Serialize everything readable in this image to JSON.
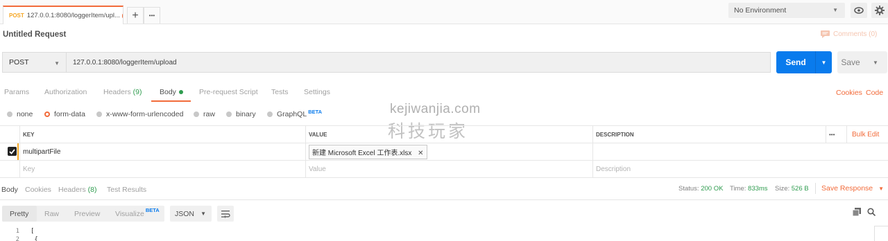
{
  "tab": {
    "method": "POST",
    "name": "127.0.0.1:8080/loggerItem/upl..."
  },
  "tab_actions": {
    "new_tab": "+",
    "more": "•••"
  },
  "environment": {
    "selected": "No Environment"
  },
  "request": {
    "title": "Untitled Request",
    "comments": "Comments (0)",
    "method": "POST",
    "url": "127.0.0.1:8080/loggerItem/upload",
    "send_label": "Send",
    "save_label": "Save"
  },
  "request_tabs": {
    "params": "Params",
    "authorization": "Authorization",
    "headers": "Headers",
    "headers_count": "(9)",
    "body": "Body",
    "pre_request": "Pre-request Script",
    "tests": "Tests",
    "settings": "Settings",
    "cookies": "Cookies",
    "code": "Code"
  },
  "body_types": {
    "none": "none",
    "form_data": "form-data",
    "urlencoded": "x-www-form-urlencoded",
    "raw": "raw",
    "binary": "binary",
    "graphql": "GraphQL",
    "beta": "BETA"
  },
  "watermark": {
    "line1": "kejiwanjia.com",
    "line2": "科技玩家"
  },
  "kv_table": {
    "headers": {
      "key": "KEY",
      "value": "VALUE",
      "description": "DESCRIPTION",
      "more": "•••",
      "bulk_edit": "Bulk Edit"
    },
    "row": {
      "key": "multipartFile",
      "value": "新建 Microsoft Excel 工作表.xlsx",
      "remove": "✕"
    },
    "placeholders": {
      "key": "Key",
      "value": "Value",
      "description": "Description"
    }
  },
  "response_tabs": {
    "body": "Body",
    "cookies": "Cookies",
    "headers": "Headers",
    "headers_count": "(8)",
    "test_results": "Test Results"
  },
  "response_status": {
    "status_label": "Status:",
    "status_value": "200 OK",
    "time_label": "Time:",
    "time_value": "833ms",
    "size_label": "Size:",
    "size_value": "526 B",
    "save_response": "Save Response"
  },
  "view_modes": {
    "pretty": "Pretty",
    "raw": "Raw",
    "preview": "Preview",
    "visualize": "Visualize",
    "beta": "BETA",
    "format": "JSON"
  },
  "code": [
    {
      "ln": "1",
      "text": "["
    },
    {
      "ln": "2",
      "text": "    {"
    }
  ],
  "colors": {
    "accent": "#f26b3a",
    "send": "#097bed",
    "success": "#2f9c4f"
  }
}
